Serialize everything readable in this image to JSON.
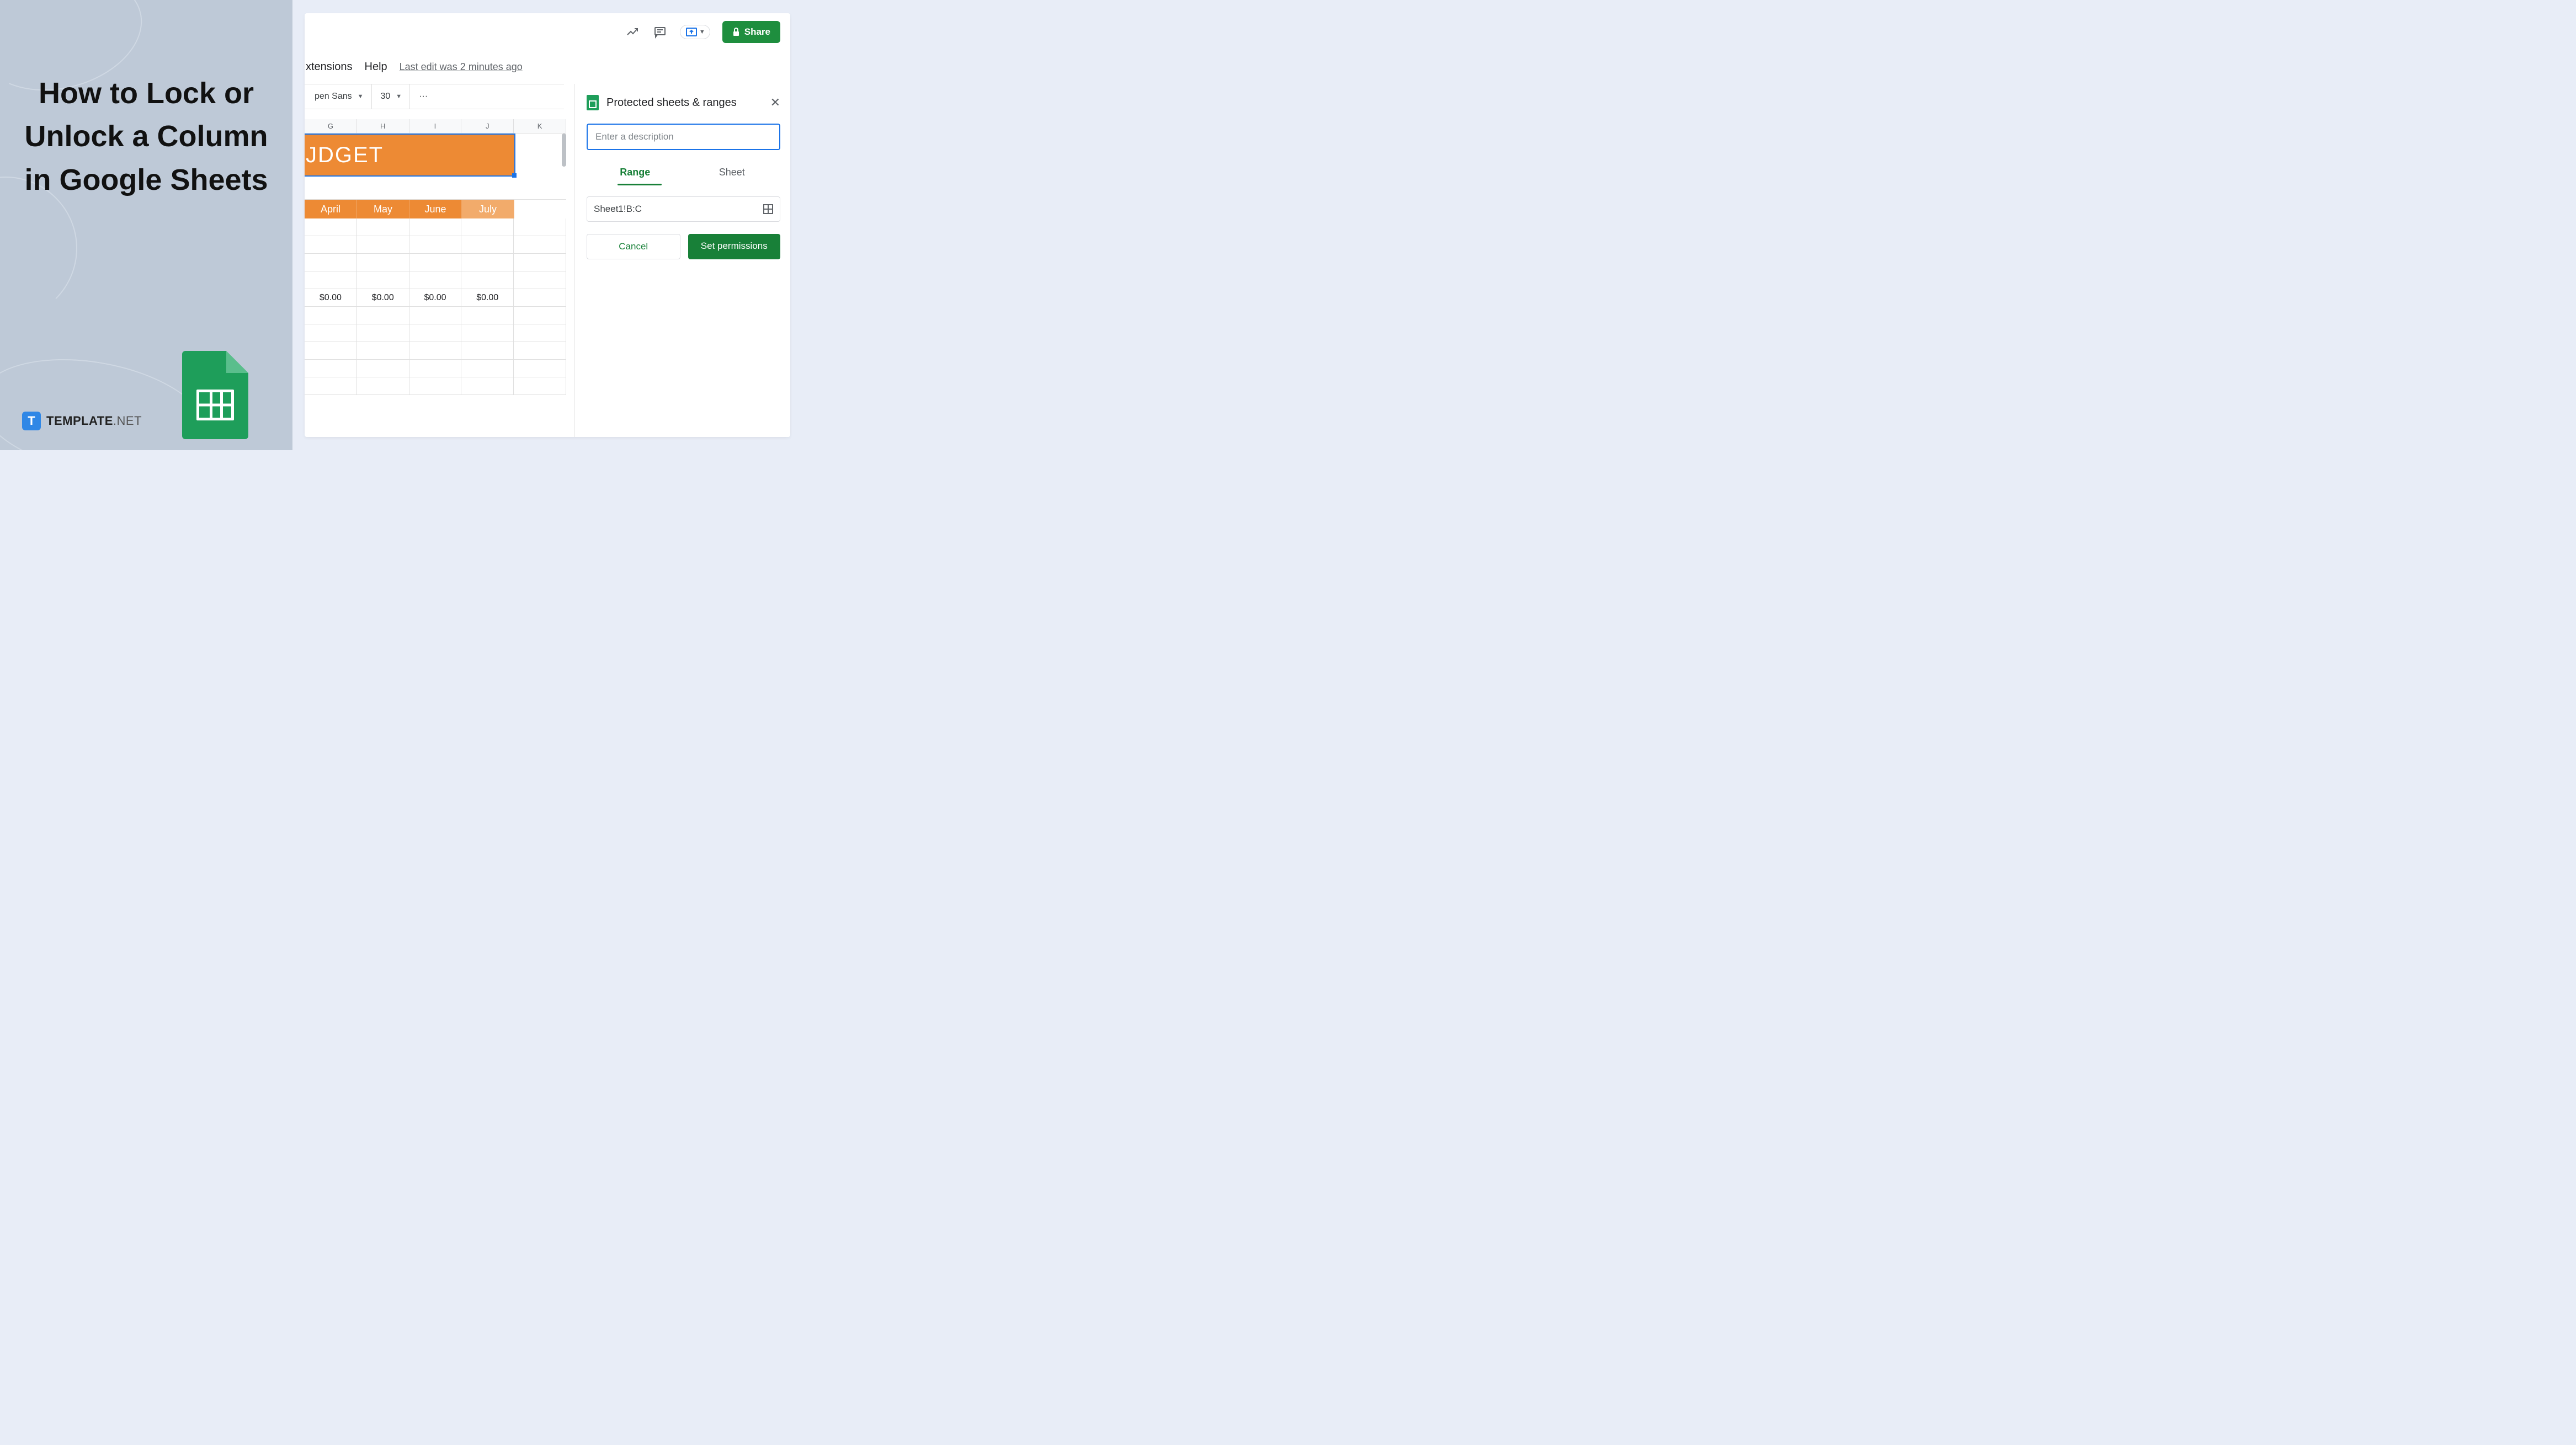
{
  "left": {
    "title": "How to Lock or Unlock a Column in Google Sheets",
    "brand_letter": "T",
    "brand_name": "TEMPLATE",
    "brand_domain": ".NET"
  },
  "menubar": {
    "extensions": "xtensions",
    "help": "Help",
    "last_edit": "Last edit was 2 minutes ago"
  },
  "toolbar": {
    "font": "pen Sans",
    "size": "30",
    "more": "···"
  },
  "top_actions": {
    "share": "Share"
  },
  "columns": [
    "G",
    "H",
    "I",
    "J",
    "K"
  ],
  "banner": "JDGET",
  "months": [
    "April",
    "May",
    "June",
    "July",
    ""
  ],
  "amount_row": [
    "$0.00",
    "$0.00",
    "$0.00",
    "$0.00",
    ""
  ],
  "side_panel": {
    "title": "Protected sheets & ranges",
    "desc_placeholder": "Enter a description",
    "tab_range": "Range",
    "tab_sheet": "Sheet",
    "range_value": "Sheet1!B:C",
    "cancel": "Cancel",
    "set": "Set permissions"
  }
}
